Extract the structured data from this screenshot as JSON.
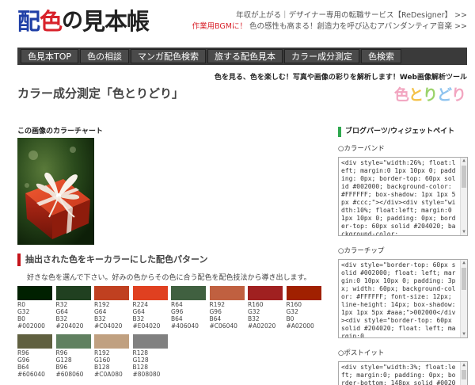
{
  "header": {
    "logo": [
      "配",
      "色",
      "の",
      "見本帳"
    ],
    "promo_line1": "年収が上がる｜デザイナー専用の転職サービス【ReDesigner】 >>",
    "promo_line2_red": "作業用BGMに！",
    "promo_line2_rest": " 色の感性も高まる！創造力を呼び込むアバンダンティア音楽 >>"
  },
  "nav": {
    "items": [
      "色見本TOP",
      "色の相談",
      "マンガ配色検索",
      "旅する配色見本",
      "カラー成分測定",
      "色検索"
    ]
  },
  "tagline": "色を見る、色を楽しむ！写真や画像の彩りを解析します！Web画像解析ツール",
  "page_title": "カラー成分測定「色とりどり」",
  "brand_mark": [
    "色",
    "と",
    "り",
    "ど",
    "り"
  ],
  "chart_heading": "この画像のカラーチャート",
  "section": {
    "heading": "抽出された色をキーカラーにした配色パターン",
    "desc": "好きな色を選んで下さい。好みの色からその色に合う配色を配色技法から導き出します。"
  },
  "swatches": [
    {
      "r": "R0",
      "g": "G32",
      "b": "B0",
      "hex": "#002000",
      "color": "#002000"
    },
    {
      "r": "R32",
      "g": "G64",
      "b": "B32",
      "hex": "#204020",
      "color": "#204020"
    },
    {
      "r": "R192",
      "g": "G64",
      "b": "B32",
      "hex": "#C04020",
      "color": "#C04020"
    },
    {
      "r": "R224",
      "g": "G64",
      "b": "B32",
      "hex": "#E04020",
      "color": "#E04020"
    },
    {
      "r": "R64",
      "g": "G96",
      "b": "B64",
      "hex": "#406040",
      "color": "#406040"
    },
    {
      "r": "R192",
      "g": "G96",
      "b": "B64",
      "hex": "#C06040",
      "color": "#C06040"
    },
    {
      "r": "R160",
      "g": "G32",
      "b": "B32",
      "hex": "#A02020",
      "color": "#A02020"
    },
    {
      "r": "R160",
      "g": "G32",
      "b": "B0",
      "hex": "#A02000",
      "color": "#A02000"
    },
    {
      "r": "R96",
      "g": "G96",
      "b": "B64",
      "hex": "#606040",
      "color": "#606040"
    },
    {
      "r": "R96",
      "g": "G128",
      "b": "B96",
      "hex": "#608060",
      "color": "#608060"
    },
    {
      "r": "R192",
      "g": "G160",
      "b": "B128",
      "hex": "#C0A080",
      "color": "#C0A080"
    },
    {
      "r": "R128",
      "g": "G128",
      "b": "B128",
      "hex": "#808080",
      "color": "#808080"
    }
  ],
  "sidebar": {
    "heading": "ブログパーツ/ウィジェットペイト",
    "widgets": [
      {
        "label": "○カラーバンド",
        "code": "<div style=\"width:26%; float:left; margin:0 1px 10px 0; padding: 0px; border-top: 60px solid #002000; background-color: #FFFFFF; box-shadow: 1px 1px 5px #ccc;\"></div><div style=\"width:10%; float:left; margin:0 1px 10px 0; padding: 0px; border-top: 60px solid #204020; background-color:"
      },
      {
        "label": "○カラーチップ",
        "code": "<div style=\"border-top: 60px solid #002000; float: left; margin:0 10px 10px 0; padding: 3px; width: 60px; background-color: #FFFFFF; font-size: 12px; line-height: 14px; box-shadow: 1px 1px 5px #aaa;\">002000</div><div style=\"border-top: 60px solid #204020; float: left; margin:0"
      },
      {
        "label": "○ポストイット",
        "code": "<div style=\"width:3%; float:left; margin:0; padding: 0px; border-bottom: 148px solid #002000;"
      }
    ]
  },
  "colors": {
    "nav_bg": "#3a3a3a",
    "accent_red": "#c4141b",
    "accent_green": "#2fa84f",
    "logo_blue": "#1f3fa6",
    "logo_red": "#d8222b"
  }
}
